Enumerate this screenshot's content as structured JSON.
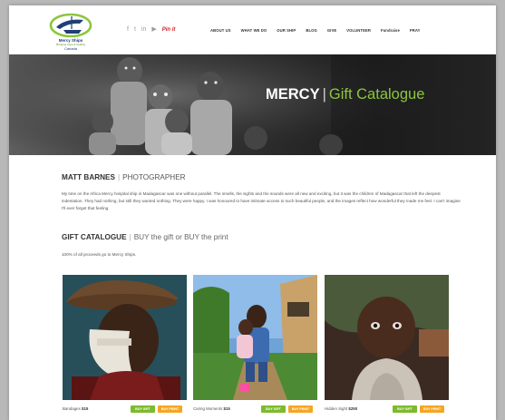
{
  "header": {
    "logo": {
      "name": "Mercy Ships",
      "tagline": "Bringing hope & healing",
      "country": "Canada"
    },
    "social": [
      {
        "icon": "facebook-icon",
        "glyph": "f"
      },
      {
        "icon": "twitter-icon",
        "glyph": "t"
      },
      {
        "icon": "linkedin-icon",
        "glyph": "in"
      },
      {
        "icon": "youtube-icon",
        "glyph": "▶"
      },
      {
        "icon": "pinterest-icon",
        "glyph": "Pin it"
      }
    ],
    "nav": [
      "ABOUT US",
      "WHAT WE DO",
      "OUR SHIP",
      "BLOG",
      "GIVE",
      "VOLUNTEER",
      "Fundraise",
      "PRAY"
    ]
  },
  "hero": {
    "word": "MERCY",
    "separator": "|",
    "subtitle": "Gift Catalogue"
  },
  "author": {
    "name": "MATT BARNES",
    "separator": "|",
    "role": "PHOTOGRAPHER",
    "bio": "My time on the Africa Mercy hospital ship in Madagascar was one without parallel. The smells, the sights and the sounds were all new and exciting, but it was the children of Madagascar that left the deepest indentation. They had nothing, but still they wanted nothing. They were happy. I was honoured to have intimate access to such beautiful people, and the images reflect how wonderful they made me feel. I can't imagine I'll ever forget that feeling."
  },
  "catalogue": {
    "title": "GIFT CATALOGUE",
    "separator": "|",
    "subtitle": "BUY the gift or BUY the print",
    "proceeds": "100% of all proceeds go to Mercy Ships."
  },
  "products": [
    {
      "name": "Bandages",
      "price": "$15",
      "buy_gift": "BUY GIFT",
      "buy_print": "BUY PRINT"
    },
    {
      "name": "Caring Moments",
      "price": "$15",
      "buy_gift": "BUY GIFT",
      "buy_print": "BUY PRINT"
    },
    {
      "name": "Hidden Sight",
      "price": "$250",
      "buy_gift": "BUY GIFT",
      "buy_print": "BUY PRINT"
    }
  ],
  "colors": {
    "accent_green": "#8cc63f",
    "gift_button": "#7dbb2e",
    "print_button": "#f5a623",
    "pinterest": "#c8232c"
  }
}
